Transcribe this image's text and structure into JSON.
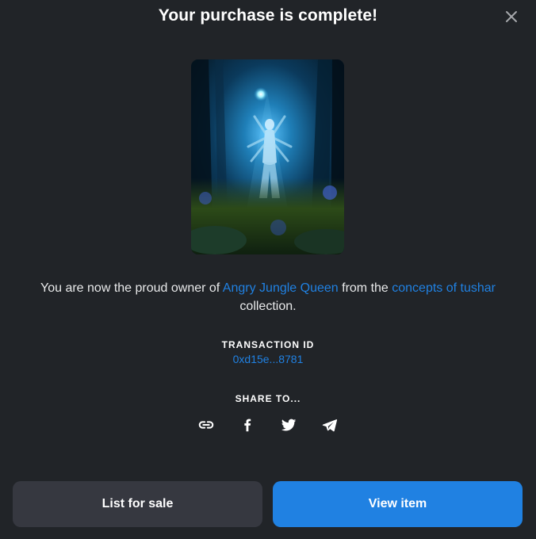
{
  "dialog": {
    "title": "Your purchase is complete!",
    "close_icon": "close-icon"
  },
  "item": {
    "image_alt": "Angry Jungle Queen artwork",
    "owner_prefix": "You are now the proud owner of ",
    "item_name": "Angry Jungle Queen",
    "from_text": " from the ",
    "collection_name": "concepts of tushar",
    "suffix": " collection."
  },
  "transaction": {
    "label": "TRANSACTION ID",
    "id": "0xd15e...8781"
  },
  "share": {
    "label": "SHARE TO...",
    "icons": [
      "link-icon",
      "facebook-icon",
      "twitter-icon",
      "telegram-icon"
    ]
  },
  "actions": {
    "list_for_sale": "List for sale",
    "view_item": "View item"
  },
  "colors": {
    "background": "#212428",
    "accent": "#2081e2",
    "secondary_button": "#363840"
  }
}
